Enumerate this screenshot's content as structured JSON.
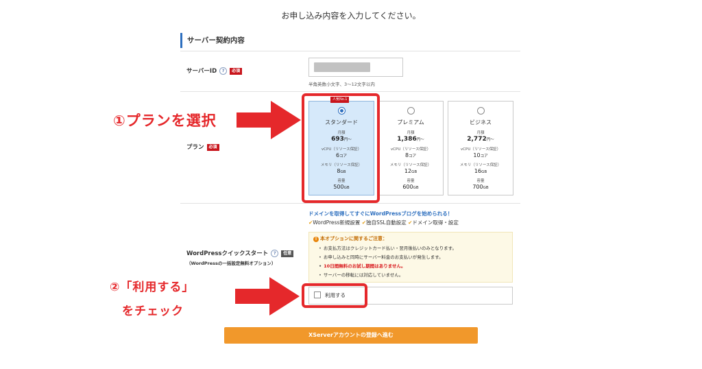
{
  "page": {
    "heading": "お申し込み内容を入力してください。"
  },
  "section": {
    "title": "サーバー契約内容"
  },
  "server_id": {
    "label": "サーバーID",
    "help": "?",
    "required_badge": "必須",
    "hint": "半角英数小文字、3〜12文字以内"
  },
  "plan": {
    "label": "プラン",
    "required_badge": "必須",
    "popular_badge": "人気No.1",
    "cards": [
      {
        "name": "スタンダード",
        "price_label": "月額",
        "price": "693",
        "price_unit": "円〜",
        "vcpu_label": "vCPU（リソース保証）",
        "vcpu": "6",
        "vcpu_unit": "コア",
        "memory_label": "メモリ（リソース保証）",
        "memory": "8",
        "memory_unit": "GB",
        "storage_label": "容量",
        "storage": "500",
        "storage_unit": "GB",
        "selected": true
      },
      {
        "name": "プレミアム",
        "price_label": "月額",
        "price": "1,386",
        "price_unit": "円〜",
        "vcpu_label": "vCPU（リソース保証）",
        "vcpu": "8",
        "vcpu_unit": "コア",
        "memory_label": "メモリ（リソース保証）",
        "memory": "12",
        "memory_unit": "GB",
        "storage_label": "容量",
        "storage": "600",
        "storage_unit": "GB",
        "selected": false
      },
      {
        "name": "ビジネス",
        "price_label": "月額",
        "price": "2,772",
        "price_unit": "円〜",
        "vcpu_label": "vCPU（リソース保証）",
        "vcpu": "10",
        "vcpu_unit": "コア",
        "memory_label": "メモリ（リソース保証）",
        "memory": "16",
        "memory_unit": "GB",
        "storage_label": "容量",
        "storage": "700",
        "storage_unit": "GB",
        "selected": false
      }
    ]
  },
  "wordpress": {
    "label": "WordPressクイックスタート",
    "help": "?",
    "optional_badge": "任意",
    "sublabel": "（WordPressの一括設定無料オプション）",
    "promo": "ドメインを取得してすぐにWordPressブログを始められる！",
    "features": [
      "WordPress新規設置",
      "独自SSL自動設定",
      "ドメイン取得・設定"
    ],
    "notice_title": "本オプションに関するご注意：",
    "notices": [
      "お支払方法はクレジットカード払い・翌月後払いのみとなります。",
      "お申し込みと同時にサーバー料金のお支払いが発生します。",
      "10日間無料のお試し期間はありません。",
      "サーバーの移転には対応していません。"
    ],
    "checkbox_label": "利用する",
    "checked": false
  },
  "submit": {
    "label": "XServerアカウントの登録へ進む"
  },
  "annotations": {
    "step1": "①プランを選択",
    "step2_line1": "②「利用する」",
    "step2_line2": "をチェック"
  },
  "colors": {
    "accent_red": "#e5282b",
    "selected_blue": "#d6e9fa",
    "submit_orange": "#f1982b",
    "link_blue": "#2d6fbf"
  }
}
